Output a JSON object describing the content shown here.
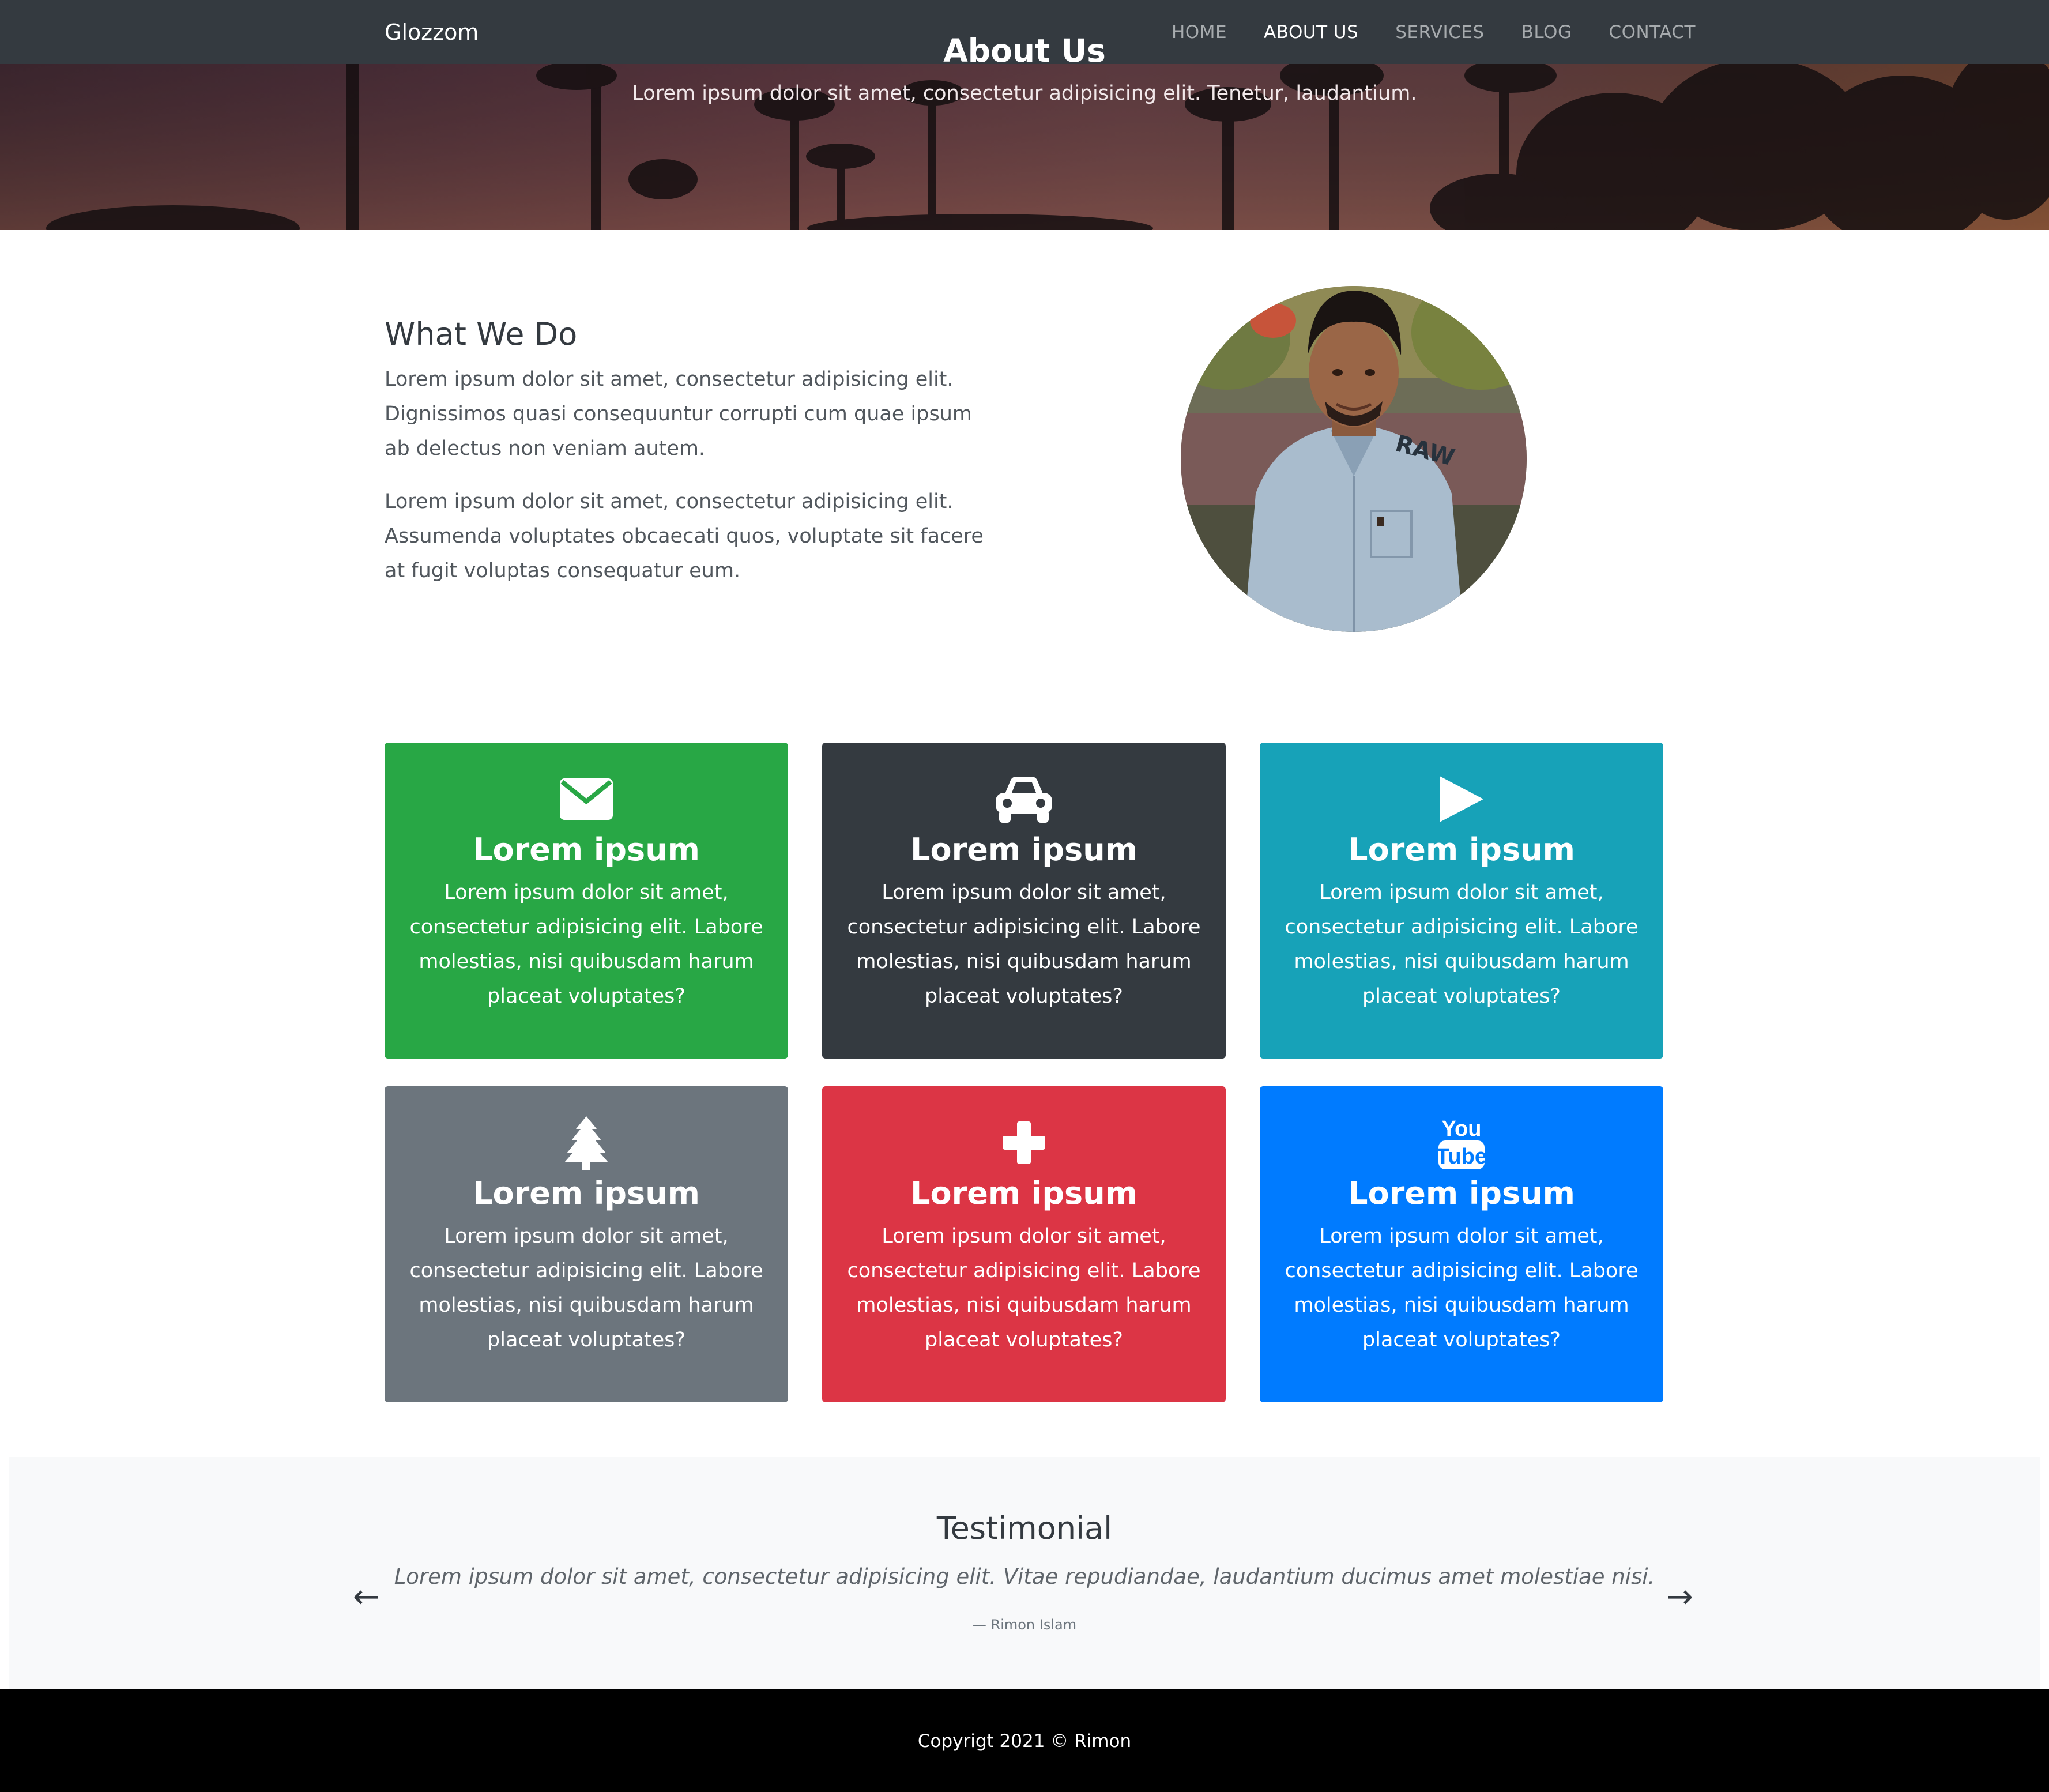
{
  "navbar": {
    "brand": "Glozzom",
    "links": [
      {
        "label": "HOME",
        "active": false
      },
      {
        "label": "ABOUT US",
        "active": true
      },
      {
        "label": "SERVICES",
        "active": false
      },
      {
        "label": "BLOG",
        "active": false
      },
      {
        "label": "CONTACT",
        "active": false
      }
    ]
  },
  "hero": {
    "title": "About Us",
    "subtitle": "Lorem ipsum dolor sit amet, consectetur adipisicing elit. Tenetur, laudantium."
  },
  "about": {
    "title": "What We Do",
    "paragraph1": "Lorem ipsum dolor sit amet, consectetur adipisicing elit. Dignissimos quasi consequuntur corrupti cum quae ipsum ab delectus non veniam autem.",
    "paragraph2": "Lorem ipsum dolor sit amet, consectetur adipisicing elit. Assumenda voluptates obcaecati quos, voluptate sit facere at fugit voluptas consequatur eum.",
    "photo_text": "RAW"
  },
  "cards": [
    {
      "icon": "envelope-icon",
      "title": "Lorem ipsum",
      "text": "Lorem ipsum dolor sit amet, consectetur adipisicing elit. Labore molestias, nisi quibusdam harum placeat voluptates?",
      "color": "#28a745"
    },
    {
      "icon": "car-icon",
      "title": "Lorem ipsum",
      "text": "Lorem ipsum dolor sit amet, consectetur adipisicing elit. Labore molestias, nisi quibusdam harum placeat voluptates?",
      "color": "#343a40"
    },
    {
      "icon": "play-icon",
      "title": "Lorem ipsum",
      "text": "Lorem ipsum dolor sit amet, consectetur adipisicing elit. Labore molestias, nisi quibusdam harum placeat voluptates?",
      "color": "#17a2b8"
    },
    {
      "icon": "tree-icon",
      "title": "Lorem ipsum",
      "text": "Lorem ipsum dolor sit amet, consectetur adipisicing elit. Labore molestias, nisi quibusdam harum placeat voluptates?",
      "color": "#6c757d"
    },
    {
      "icon": "plus-icon",
      "title": "Lorem ipsum",
      "text": "Lorem ipsum dolor sit amet, consectetur adipisicing elit. Labore molestias, nisi quibusdam harum placeat voluptates?",
      "color": "#dc3545"
    },
    {
      "icon": "youtube-icon",
      "title": "Lorem ipsum",
      "text": "Lorem ipsum dolor sit amet, consectetur adipisicing elit. Labore molestias, nisi quibusdam harum placeat voluptates?",
      "color": "#007bff",
      "icon_text_top": "You",
      "icon_text_bottom": "Tube"
    }
  ],
  "testimonial": {
    "title": "Testimonial",
    "quote": "Lorem ipsum dolor sit amet, consectetur adipisicing elit. Vitae repudiandae, laudantium ducimus amet molestiae nisi.",
    "author": "— Rimon Islam",
    "prev": "←",
    "next": "→"
  },
  "footer": {
    "copyright": "Copyrigt 2021 © Rimon"
  }
}
